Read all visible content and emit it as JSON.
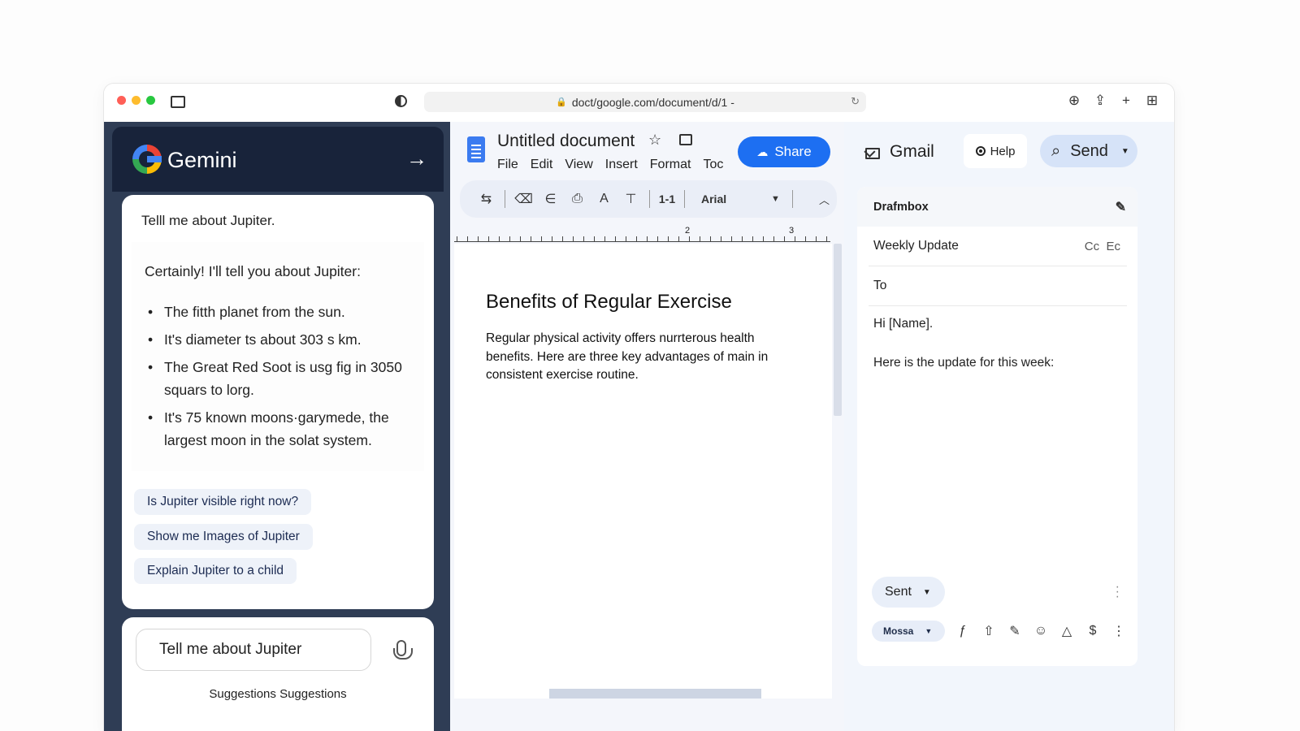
{
  "browser": {
    "url": "doct/google.com/document/d/1 -",
    "traffic_colors": [
      "#ff5f57",
      "#febc2e",
      "#28c840"
    ]
  },
  "gemini": {
    "title": "Gemini",
    "prompt": "Telll me about Jupiter.",
    "response_intro": "Certainly! I'll tell you about Jupiter:",
    "response_points": [
      "The fitth planet from the sun.",
      "It's diameter ts about 303 s km.",
      "The Great Red Soot is usg fig in 3050 squars to lorg.",
      "It's 75 known moons·garymede, the largest moon in the solat system."
    ],
    "suggestions": [
      "Is Jupiter visible right now?",
      "Show me Images of Jupiter",
      "Explain Jupiter to a child"
    ],
    "input_value": "Tell me about Jupiter",
    "input_hint": "Suggestions Suggestions"
  },
  "docs": {
    "title": "Untitled document",
    "menu": [
      "File",
      "Edit",
      "View",
      "Insert",
      "Format",
      "Toc"
    ],
    "share_label": "Share",
    "toolbar": {
      "zoom": "1-1",
      "font": "Arial"
    },
    "ruler_labels": [
      "2",
      "3"
    ],
    "heading": "Benefits of Regular Exercise",
    "body": "Regular physical activity offers nurrterous health benefits. Here are three key advantages of main in consistent exercise routine."
  },
  "gmail": {
    "title": "Gmail",
    "help_label": "Help",
    "send_label": "Send",
    "draft_label": "Drafmbox",
    "subject": "Weekly Update",
    "cc_label": "Cc",
    "bcc_label": "Ec",
    "to_label": "To",
    "greeting": "Hi [Name].",
    "body_line": "Here is the update for this week:",
    "sent_label": "Sent",
    "account_label": "Mossa"
  }
}
